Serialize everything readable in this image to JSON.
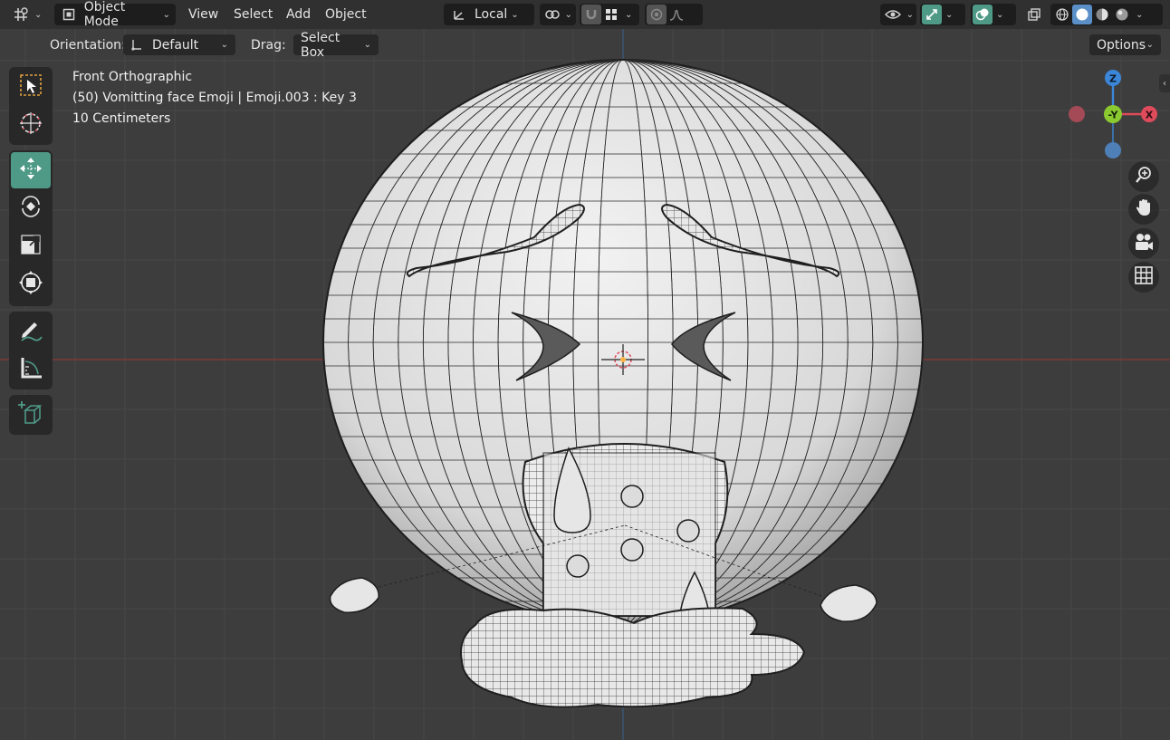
{
  "header": {
    "editor_type_icon": "grid-editor-icon",
    "mode_label": "Object Mode",
    "menus": [
      "View",
      "Select",
      "Add",
      "Object"
    ],
    "orientation_label": "Local",
    "snap_icon": "magnet-icon"
  },
  "tool_settings": {
    "orientation_label": "Orientation:",
    "orientation_value": "Default",
    "drag_label": "Drag:",
    "drag_value": "Select Box",
    "options_label": "Options"
  },
  "overlay": {
    "view_name": "Front Orthographic",
    "object_info": "(50) Vomitting face Emoji | Emoji.003 : Key 3",
    "scale_info": "10 Centimeters"
  },
  "gizmo": {
    "axes": [
      "Z",
      "-Y",
      "X"
    ],
    "colors": {
      "x": "#e04b5c",
      "y": "#8ac92f",
      "z": "#3b86d8",
      "accent": "#4f9a87"
    }
  },
  "toolbar": {
    "tools": [
      "select-box-icon",
      "cursor-icon",
      "move-icon",
      "rotate-icon",
      "scale-icon",
      "transform-icon",
      "annotate-icon",
      "measure-icon",
      "add-cube-icon"
    ]
  },
  "navigation": [
    "zoom-icon",
    "hand-icon",
    "camera-icon",
    "grid-view-icon"
  ]
}
